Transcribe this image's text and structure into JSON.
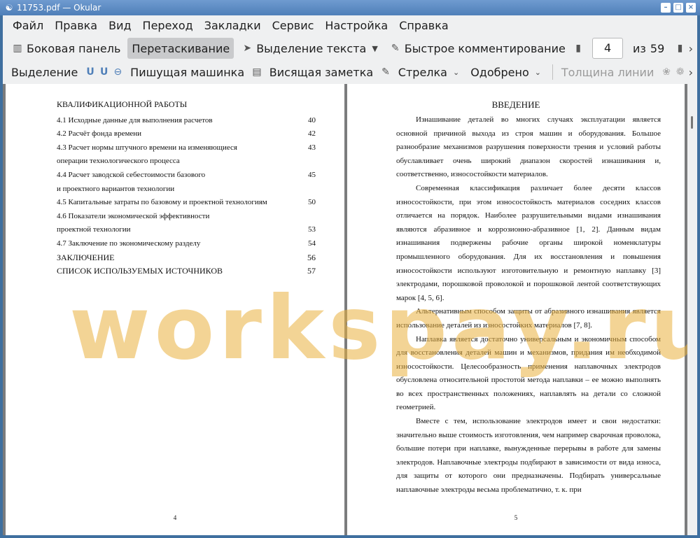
{
  "window": {
    "title": "11753.pdf — Okular"
  },
  "menu": [
    "Файл",
    "Правка",
    "Вид",
    "Переход",
    "Закладки",
    "Сервис",
    "Настройка",
    "Справка"
  ],
  "toolbar1": {
    "sidebar": "Боковая панель",
    "drag": "Перетаскивание",
    "text_select": "Выделение текста",
    "quick_annot": "Быстрое комментирование",
    "page_current": "4",
    "page_of": "из",
    "page_total": "59"
  },
  "toolbar2": {
    "highlight": "Выделение",
    "typewriter": "Пишущая машинка",
    "note": "Висящая заметка",
    "arrow": "Стрелка",
    "stamp": "Одобрено",
    "line_width": "Толщина линии"
  },
  "left_page": {
    "heading": "КВАЛИФИКАЦИОННОЙ РАБОТЫ",
    "toc": [
      {
        "text": "4.1 Исходные данные для выполнения расчетов",
        "page": "40"
      },
      {
        "text": "4.2 Расчёт фонда времени",
        "page": "42"
      },
      {
        "text": "4.3 Расчет нормы штучного времени на изменяющиеся",
        "page": "43"
      },
      {
        "text": "операции технологического процесса",
        "page": ""
      },
      {
        "text": "4.4 Расчет заводской себестоимости базового",
        "page": "45"
      },
      {
        "text": "и проектного вариантов технологии",
        "page": ""
      },
      {
        "text": "4.5 Капитальные затраты по базовому и проектной технологиям",
        "page": "50"
      },
      {
        "text": "4.6 Показатели экономической эффективности",
        "page": ""
      },
      {
        "text": "проектной технологии",
        "page": "53"
      },
      {
        "text": "4.7 Заключение по экономическому разделу",
        "page": "54"
      },
      {
        "text": "ЗАКЛЮЧЕНИЕ",
        "page": "56"
      },
      {
        "text": "СПИСОК ИСПОЛЬЗУЕМЫХ ИСТОЧНИКОВ",
        "page": "57"
      }
    ],
    "page_number": "4"
  },
  "right_page": {
    "title": "ВВЕДЕНИЕ",
    "paragraphs": [
      "Изнашивание деталей во многих случаях эксплуатации является основной причиной выхода из строя машин и оборудования. Большое разнообразие механизмов разрушения поверхности трения и условий работы обуславливает очень широкий диапазон скоростей изнашивания и, соответственно, износостойкости материалов.",
      "Современная классификация различает более десяти классов износостойкости, при этом износостойкость материалов соседних классов отличается на порядок. Наиболее разрушительными видами изнашивания являются абразивное и коррозионно-абразивное [1, 2]. Данным видам изнашивания подвержены рабочие органы широкой номенклатуры промышленного оборудования. Для их восстановления и повышения износостойкости используют изготовительную и ремонтную наплавку [3] электродами, порошковой проволокой и порошковой лентой соответствующих марок [4, 5, 6].",
      "Альтернативным способом защиты от абразивного изнашивания является использование деталей из износостойких материалов [7, 8].",
      "Наплавка является достаточно универсальным и экономичным способом для восстановления деталей машин и механизмов, придания им необходимой износостойкости. Целесообразность применения наплавочных электродов обусловлена относительной простотой метода наплавки – ее можно выполнять во всех пространственных положениях, наплавлять на детали со сложной геометрией.",
      "Вместе с тем, использование электродов имеет и свои недостатки: значительно выше стоимость изготовления, чем например сварочная проволока, большие потери при наплавке, вынужденные перерывы в работе для замены электродов. Наплавочные электроды подбирают в зависимости от вида износа, для защиты от которого они предназначены. Подбирать универсальные наплавочные электроды весьма проблематично, т. к. при"
    ],
    "page_number": "5"
  },
  "watermark": "workspay.ru"
}
